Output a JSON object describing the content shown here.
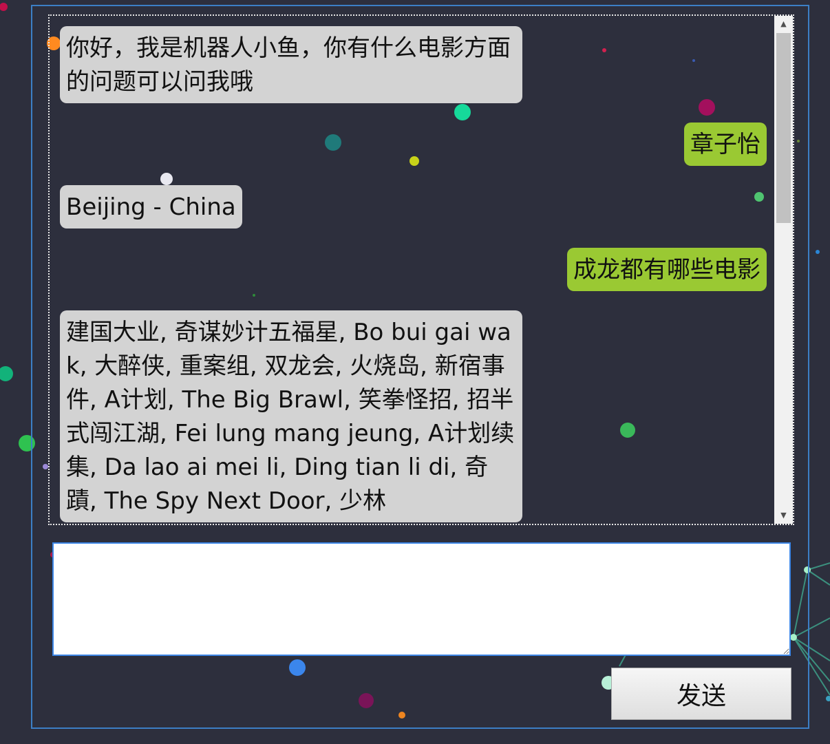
{
  "colors": {
    "page_background": "#2d2f3d",
    "frame_border": "#3c7fc6",
    "bot_bubble": "#d3d3d3",
    "user_bubble": "#9ac933",
    "input_border": "#3c86e6"
  },
  "chat": {
    "messages": [
      {
        "sender": "bot",
        "text": "你好，我是机器人小鱼，你有什么电影方面的问题可以问我哦"
      },
      {
        "sender": "user",
        "text": "章子怡"
      },
      {
        "sender": "bot",
        "text": "Beijing - China"
      },
      {
        "sender": "user",
        "text": "成龙都有哪些电影"
      },
      {
        "sender": "bot",
        "text": "建国大业, 奇谋妙计五福星, Bo bui gai wak, 大醉侠, 重案组, 双龙会, 火烧岛, 新宿事件, A计划, The Big Brawl, 笑拳怪招, 招半式闯江湖, Fei lung mang jeung, A计划续集, Da lao ai mei li, Ding tian li di, 奇蹟, The Spy Next Door, 少林"
      }
    ]
  },
  "input": {
    "value": "",
    "placeholder": ""
  },
  "send_button": {
    "label": "发送"
  }
}
